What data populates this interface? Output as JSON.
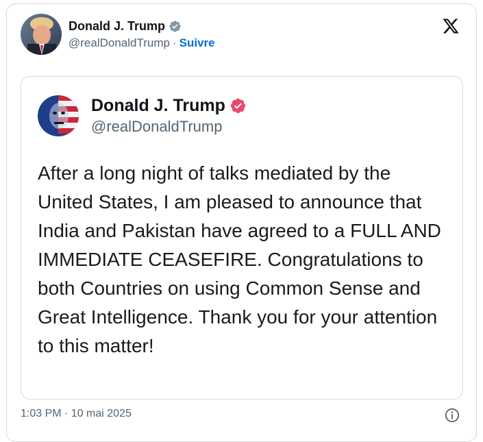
{
  "author": {
    "display_name": "Donald J. Trump",
    "handle": "@realDonaldTrump",
    "separator": "·",
    "follow_label": "Suivre"
  },
  "embedded_post": {
    "display_name": "Donald J. Trump",
    "handle": "@realDonaldTrump",
    "text": "After a long night of talks mediated by the United States, I am pleased to announce that India and Pakistan have agreed to a FULL AND IMMEDIATE CEASEFIRE. Congratulations to both Countries on using Common Sense and Great Intelligence. Thank you for your attention to this matter!"
  },
  "footer": {
    "timestamp": "1:03 PM · 10 mai 2025"
  },
  "icons": {
    "logo": "x-logo-icon",
    "verified_gray": "verified-badge-gray-icon",
    "verified_pink": "verified-badge-pink-icon",
    "info": "info-icon"
  },
  "colors": {
    "follow_link": "#006fd6",
    "verified_gray": "#829aab",
    "verified_pink": "#e8496b",
    "border": "#cfd9de",
    "secondary_text": "#536471"
  }
}
